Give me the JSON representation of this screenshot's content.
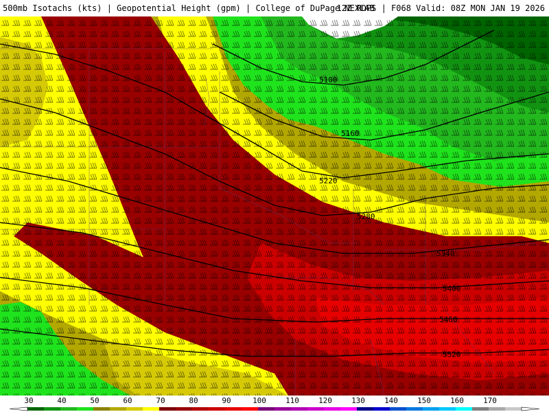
{
  "header": {
    "title": "500mb Isotachs (kts) | Geopotential Height (gpm) | College of DuPage NEXLAB",
    "run_info": "12Z RDPS | F068 Valid: 08Z MON JAN 19 2026"
  },
  "map": {
    "height_contours": [
      {
        "label": "5100"
      },
      {
        "label": "5160"
      },
      {
        "label": "5220"
      },
      {
        "label": "5280"
      },
      {
        "label": "5340"
      },
      {
        "label": "5400"
      },
      {
        "label": "5460"
      },
      {
        "label": "5520"
      }
    ]
  },
  "colorbar": {
    "labels": [
      "30",
      "40",
      "50",
      "60",
      "70",
      "80",
      "90",
      "100",
      "110",
      "120",
      "130",
      "140",
      "150",
      "160",
      "170"
    ],
    "colors": [
      "#006400",
      "#119311",
      "#22b81e",
      "#1fe31c",
      "#8c8200",
      "#b3a800",
      "#d6ca06",
      "#ffff00",
      "#7e0000",
      "#990000",
      "#b30000",
      "#cc0000",
      "#e60000",
      "#ff0000",
      "#7a007a",
      "#990099",
      "#b300b3",
      "#cc00cc",
      "#e600e6",
      "#ff00ff",
      "#00008b",
      "#0000cd",
      "#0050d0",
      "#0078e0",
      "#00a0f0",
      "#00c8ff",
      "#00ffff",
      "#808080",
      "#a9a9a9",
      "#c8c8c8"
    ]
  }
}
